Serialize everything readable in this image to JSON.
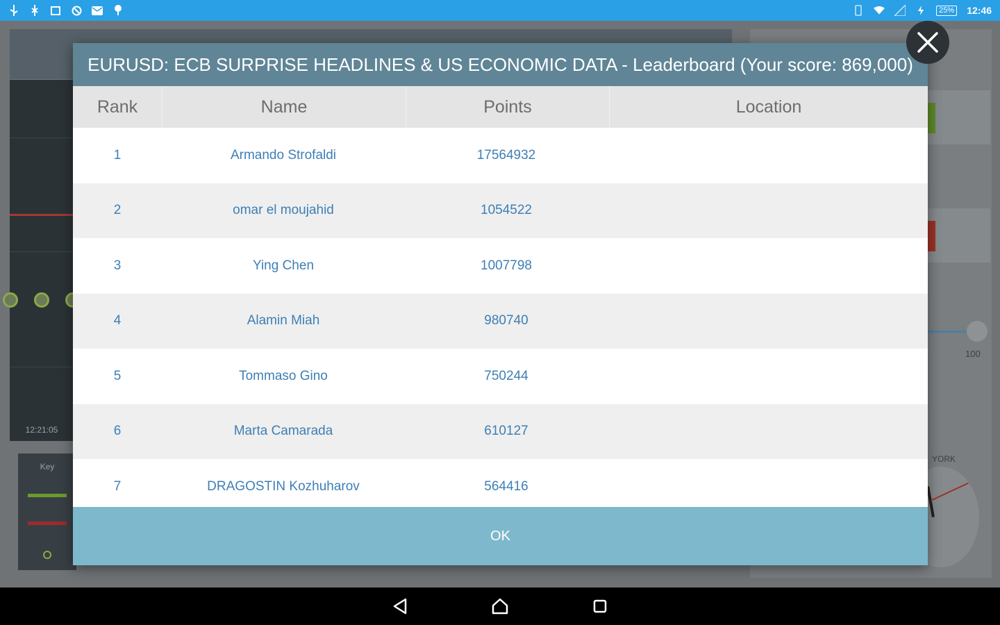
{
  "status_bar": {
    "battery": "25%",
    "time": "12:46"
  },
  "background": {
    "chart_time": "12:21:05",
    "key_label": "Key",
    "slider_max": "100",
    "clock_city": "YORK"
  },
  "dialog": {
    "title": "EURUSD: ECB SURPRISE HEADLINES & US ECONOMIC DATA - Leaderboard (Your score: 869,000)",
    "columns": [
      "Rank",
      "Name",
      "Points",
      "Location"
    ],
    "rows": [
      {
        "rank": "1",
        "name": "Armando Strofaldi",
        "points": "17564932",
        "location": ""
      },
      {
        "rank": "2",
        "name": "omar el moujahid",
        "points": "1054522",
        "location": ""
      },
      {
        "rank": "3",
        "name": "Ying Chen",
        "points": "1007798",
        "location": ""
      },
      {
        "rank": "4",
        "name": "Alamin Miah",
        "points": "980740",
        "location": ""
      },
      {
        "rank": "5",
        "name": "Tommaso Gino",
        "points": "750244",
        "location": ""
      },
      {
        "rank": "6",
        "name": "Marta Camarada",
        "points": "610127",
        "location": ""
      },
      {
        "rank": "7",
        "name": "DRAGOSTIN Kozhuharov",
        "points": "564416",
        "location": ""
      }
    ],
    "ok_label": "OK"
  },
  "colors": {
    "status_bar": "#2aa0e6",
    "title_bar": "#5f8596",
    "header_row": "#e4e4e4",
    "link_text": "#3e7fb5",
    "ok_bar": "#7eb8cc"
  }
}
